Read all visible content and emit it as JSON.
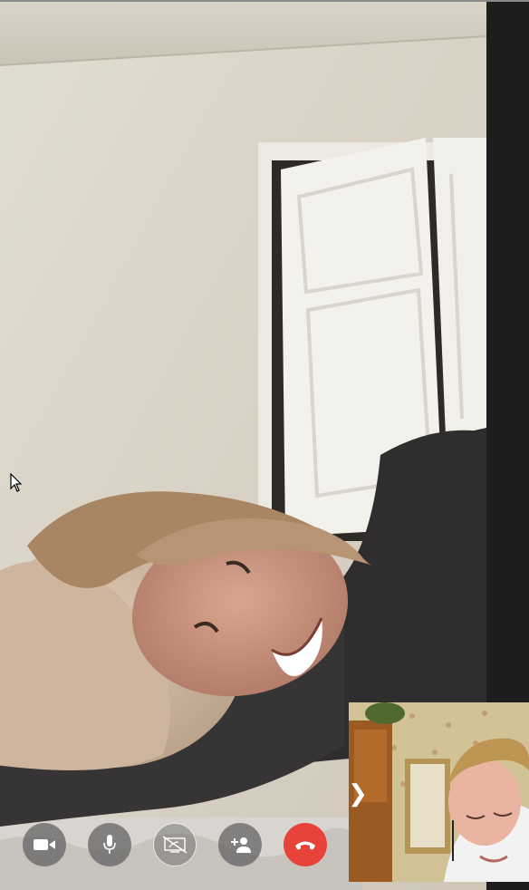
{
  "app": {
    "window_title": ""
  },
  "call": {
    "remote_video": {
      "description_icon": "remote-participant-video"
    },
    "self_view": {
      "icon": "self-camera-preview",
      "collapse_glyph": "❯"
    },
    "controls": [
      {
        "id": "toggle-video",
        "icon": "video-camera-icon",
        "state": "on"
      },
      {
        "id": "toggle-mic",
        "icon": "microphone-icon",
        "state": "on"
      },
      {
        "id": "share-screen",
        "icon": "screen-share-icon",
        "state": "off"
      },
      {
        "id": "add-participant",
        "icon": "add-person-icon"
      },
      {
        "id": "end-call",
        "icon": "hang-up-icon"
      }
    ]
  },
  "colors": {
    "end_call": "#e7433b",
    "control_bg": "#5f5f5f",
    "side_strip": "#1d1d1d"
  }
}
